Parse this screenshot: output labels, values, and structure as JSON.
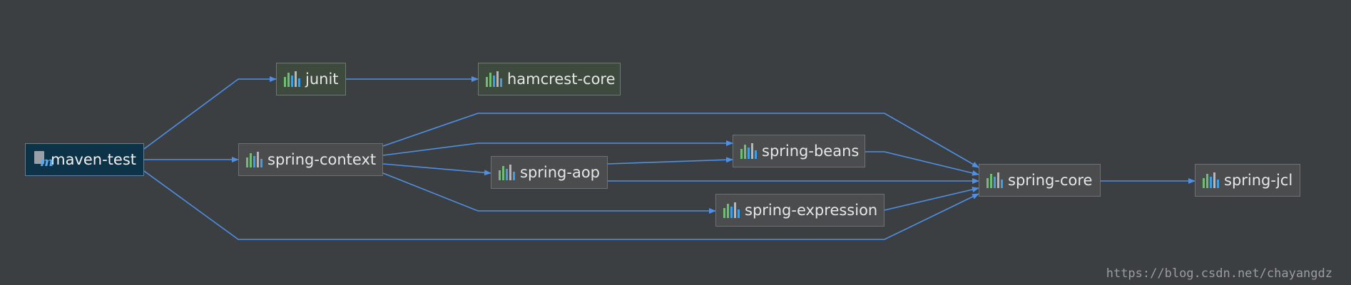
{
  "colors": {
    "background": "#3c3f41",
    "edge": "#4f8fe6",
    "node_fill": "#4a4c4e",
    "test_scope_fill": "#3f4a3f",
    "selected_fill": "#0d3349",
    "icon_bar_green": "#6fbf73",
    "icon_bar_blue": "#3f9fe6",
    "icon_bar_gray": "#b7b7b7"
  },
  "nodes": {
    "root": {
      "label": "maven-test",
      "icon": "maven-module-icon"
    },
    "junit": {
      "label": "junit",
      "icon": "library-icon"
    },
    "hamcrest": {
      "label": "hamcrest-core",
      "icon": "library-icon"
    },
    "context": {
      "label": "spring-context",
      "icon": "library-icon"
    },
    "beans": {
      "label": "spring-beans",
      "icon": "library-icon"
    },
    "aop": {
      "label": "spring-aop",
      "icon": "library-icon"
    },
    "expression": {
      "label": "spring-expression",
      "icon": "library-icon"
    },
    "core": {
      "label": "spring-core",
      "icon": "library-icon"
    },
    "jcl": {
      "label": "spring-jcl",
      "icon": "library-icon"
    }
  },
  "edges": [
    {
      "from": "maven-test",
      "to": "junit"
    },
    {
      "from": "junit",
      "to": "hamcrest-core"
    },
    {
      "from": "maven-test",
      "to": "spring-context"
    },
    {
      "from": "maven-test",
      "to": "spring-core"
    },
    {
      "from": "spring-context",
      "to": "spring-beans"
    },
    {
      "from": "spring-context",
      "to": "spring-aop"
    },
    {
      "from": "spring-context",
      "to": "spring-expression"
    },
    {
      "from": "spring-context",
      "to": "spring-core"
    },
    {
      "from": "spring-aop",
      "to": "spring-beans"
    },
    {
      "from": "spring-aop",
      "to": "spring-core"
    },
    {
      "from": "spring-beans",
      "to": "spring-core"
    },
    {
      "from": "spring-expression",
      "to": "spring-core"
    },
    {
      "from": "spring-core",
      "to": "spring-jcl"
    }
  ],
  "watermark": "https://blog.csdn.net/chayangdz"
}
